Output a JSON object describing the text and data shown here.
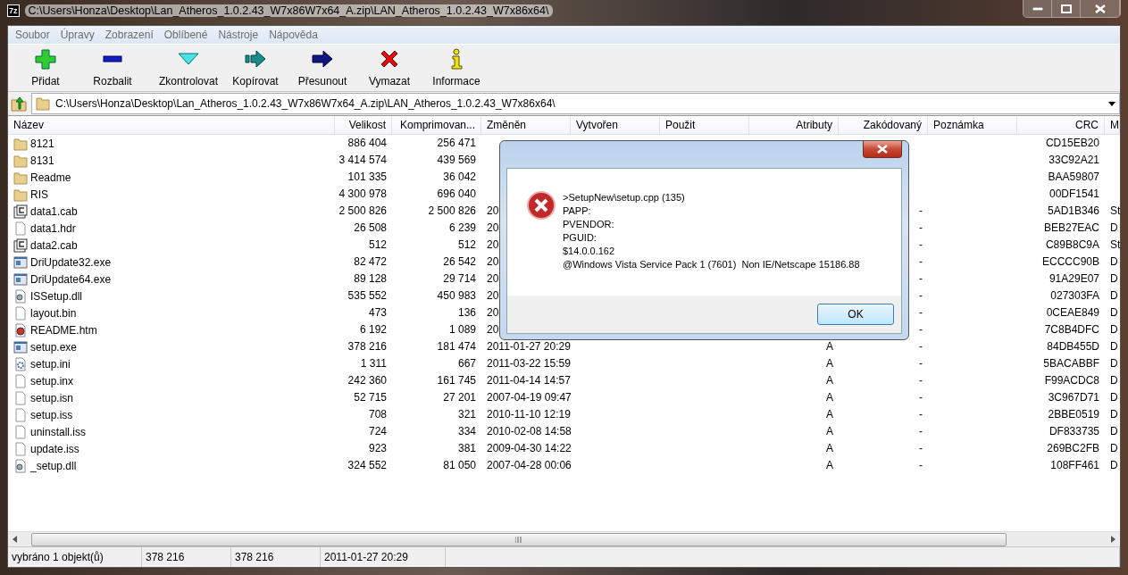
{
  "window": {
    "title": "C:\\Users\\Honza\\Desktop\\Lan_Atheros_1.0.2.43_W7x86W7x64_A.zip\\LAN_Atheros_1.0.2.43_W7x86x64\\",
    "app_icon": "7z"
  },
  "menu": [
    "Soubor",
    "Úpravy",
    "Zobrazení",
    "Oblíbené",
    "Nástroje",
    "Nápověda"
  ],
  "toolbar": [
    {
      "kind": "add",
      "label": "Přidat"
    },
    {
      "kind": "extract",
      "label": "Rozbalit"
    },
    {
      "kind": "test",
      "label": "Zkontrolovat"
    },
    {
      "kind": "copy",
      "label": "Kopírovat"
    },
    {
      "kind": "move",
      "label": "Přesunout"
    },
    {
      "kind": "delete",
      "label": "Vymazat"
    },
    {
      "kind": "info",
      "label": "Informace"
    }
  ],
  "address": {
    "value": "C:\\Users\\Honza\\Desktop\\Lan_Atheros_1.0.2.43_W7x86W7x64_A.zip\\LAN_Atheros_1.0.2.43_W7x86x64\\"
  },
  "table": {
    "columns": [
      "Název",
      "Velikost",
      "Komprimovan...",
      "Změněn",
      "Vytvořen",
      "Použit",
      "Atributy",
      "Zakódovaný",
      "Poznámka",
      "CRC",
      "M"
    ],
    "rows": [
      {
        "kind": "folder",
        "name": "8121",
        "size": "886 404",
        "packed": "256 471",
        "crc": "CD15EB20"
      },
      {
        "kind": "folder",
        "name": "8131",
        "size": "3 414 574",
        "packed": "439 569",
        "crc": "33C92A21"
      },
      {
        "kind": "folder",
        "name": "Readme",
        "size": "101 335",
        "packed": "36 042",
        "crc": "BAA59807"
      },
      {
        "kind": "folder",
        "name": "RIS",
        "size": "4 300 978",
        "packed": "696 040",
        "crc": "00DF1541"
      },
      {
        "kind": "cab",
        "name": "data1.cab",
        "size": "2 500 826",
        "packed": "2 500 826",
        "modified": "20",
        "encrypted": "-",
        "crc": "5AD1B346",
        "method": "St"
      },
      {
        "kind": "file",
        "name": "data1.hdr",
        "size": "26 508",
        "packed": "6 239",
        "modified": "20",
        "encrypted": "-",
        "crc": "BEB27EAC",
        "method": "D"
      },
      {
        "kind": "cab",
        "name": "data2.cab",
        "size": "512",
        "packed": "512",
        "modified": "20",
        "encrypted": "-",
        "crc": "C89B8C9A",
        "method": "St"
      },
      {
        "kind": "exe",
        "name": "DriUpdate32.exe",
        "size": "82 472",
        "packed": "26 542",
        "modified": "20",
        "encrypted": "-",
        "crc": "ECCCC90B",
        "method": "D"
      },
      {
        "kind": "exe",
        "name": "DriUpdate64.exe",
        "size": "89 128",
        "packed": "29 714",
        "modified": "20",
        "encrypted": "-",
        "crc": "91A29E07",
        "method": "D"
      },
      {
        "kind": "dll",
        "name": "ISSetup.dll",
        "size": "535 552",
        "packed": "450 983",
        "modified": "20",
        "encrypted": "-",
        "crc": "027303FA",
        "method": "D"
      },
      {
        "kind": "file",
        "name": "layout.bin",
        "size": "473",
        "packed": "136",
        "modified": "20",
        "encrypted": "-",
        "crc": "0CEAE849",
        "method": "D"
      },
      {
        "kind": "htm",
        "name": "README.htm",
        "size": "6 192",
        "packed": "1 089",
        "modified": "20",
        "encrypted": "-",
        "crc": "7C8B4DFC",
        "method": "D"
      },
      {
        "kind": "exe",
        "name": "setup.exe",
        "size": "378 216",
        "packed": "181 474",
        "modified": "2011-01-27 20:29",
        "attributes": "A",
        "encrypted": "-",
        "crc": "84DB455D",
        "method": "D"
      },
      {
        "kind": "ini",
        "name": "setup.ini",
        "size": "1 311",
        "packed": "667",
        "modified": "2011-03-22 15:59",
        "attributes": "A",
        "encrypted": "-",
        "crc": "5BACABBF",
        "method": "D"
      },
      {
        "kind": "file",
        "name": "setup.inx",
        "size": "242 360",
        "packed": "161 745",
        "modified": "2011-04-14 14:57",
        "attributes": "A",
        "encrypted": "-",
        "crc": "F99ACDC8",
        "method": "D"
      },
      {
        "kind": "file",
        "name": "setup.isn",
        "size": "52 715",
        "packed": "27 201",
        "modified": "2007-04-19 09:47",
        "attributes": "A",
        "encrypted": "-",
        "crc": "3C967D71",
        "method": "D"
      },
      {
        "kind": "file",
        "name": "setup.iss",
        "size": "708",
        "packed": "321",
        "modified": "2010-11-10 12:19",
        "attributes": "A",
        "encrypted": "-",
        "crc": "2BBE0519",
        "method": "D"
      },
      {
        "kind": "file",
        "name": "uninstall.iss",
        "size": "724",
        "packed": "334",
        "modified": "2010-02-08 14:58",
        "attributes": "A",
        "encrypted": "-",
        "crc": "DF833735",
        "method": "D"
      },
      {
        "kind": "file",
        "name": "update.iss",
        "size": "923",
        "packed": "381",
        "modified": "2009-04-30 14:22",
        "attributes": "A",
        "encrypted": "-",
        "crc": "269BC2FB",
        "method": "D"
      },
      {
        "kind": "dll",
        "name": "_setup.dll",
        "size": "324 552",
        "packed": "81 050",
        "modified": "2007-04-28 00:06",
        "attributes": "A",
        "encrypted": "-",
        "crc": "108FF461",
        "method": "D"
      }
    ]
  },
  "status_bar": [
    "vybráno 1 objekt(ů)",
    "378 216",
    "378 216",
    "2011-01-27 20:29"
  ],
  "dialog": {
    "lines": [
      ">SetupNew\\setup.cpp (135)",
      "PAPP:",
      "PVENDOR:",
      "PGUID:",
      "$14.0.0.162",
      "@Windows Vista Service Pack 1 (7601)  Non IE/Netscape 15186.88"
    ],
    "button": "OK"
  }
}
